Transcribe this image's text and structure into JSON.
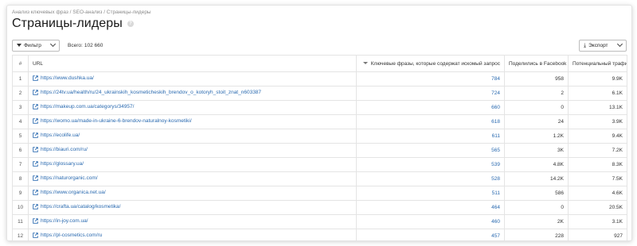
{
  "breadcrumb": "Анализ ключевых фраз / SEO-анализ / Страницы-лидеры",
  "page_title": "Страницы-лидеры",
  "help_icon_glyph": "?",
  "toolbar": {
    "filter_label": "Фильтр",
    "total_label": "Всего:",
    "total_value": "102 660",
    "export_label": "Экспорт"
  },
  "table": {
    "headers": {
      "num": "#",
      "url": "URL",
      "keywords": "Ключевые фразы, которые содержат искомый запрос",
      "facebook": "Поделились в Facebook",
      "traffic": "Потенциальный трафик"
    },
    "rows": [
      {
        "num": "1",
        "url": "https://www.dushka.ua/",
        "keywords": "784",
        "facebook": "958",
        "traffic": "9.9K"
      },
      {
        "num": "2",
        "url": "https://24tv.ua/health/ru/24_ukrainskih_kosmeticheskih_brendov_o_kotoryh_stoit_znat_n603387",
        "keywords": "724",
        "facebook": "2",
        "traffic": "6.1K"
      },
      {
        "num": "3",
        "url": "https://makeup.com.ua/categorys/34957/",
        "keywords": "660",
        "facebook": "0",
        "traffic": "13.1K"
      },
      {
        "num": "4",
        "url": "https://womo.ua/made-in-ukraine-6-brendov-naturalnoy-kosmetiki/",
        "keywords": "618",
        "facebook": "24",
        "traffic": "3.9K"
      },
      {
        "num": "5",
        "url": "https://ecolife.ua/",
        "keywords": "611",
        "facebook": "1.2K",
        "traffic": "9.4K"
      },
      {
        "num": "6",
        "url": "https://biauri.com/ru/",
        "keywords": "565",
        "facebook": "3K",
        "traffic": "7.2K"
      },
      {
        "num": "7",
        "url": "https://glossary.ua/",
        "keywords": "539",
        "facebook": "4.8K",
        "traffic": "8.3K"
      },
      {
        "num": "8",
        "url": "https://naturorganic.com/",
        "keywords": "528",
        "facebook": "14.2K",
        "traffic": "7.5K"
      },
      {
        "num": "9",
        "url": "https://www.organica.net.ua/",
        "keywords": "511",
        "facebook": "586",
        "traffic": "4.6K"
      },
      {
        "num": "10",
        "url": "https://crafta.ua/catalog/kosmetika/",
        "keywords": "464",
        "facebook": "0",
        "traffic": "20.5K"
      },
      {
        "num": "11",
        "url": "https://in-joy.com.ua/",
        "keywords": "460",
        "facebook": "2K",
        "traffic": "3.1K"
      },
      {
        "num": "12",
        "url": "https://pl-cosmetics.com/ru",
        "keywords": "457",
        "facebook": "228",
        "traffic": "927"
      }
    ]
  },
  "colors": {
    "link": "#2a6ab0",
    "border": "#e4e4e4"
  }
}
